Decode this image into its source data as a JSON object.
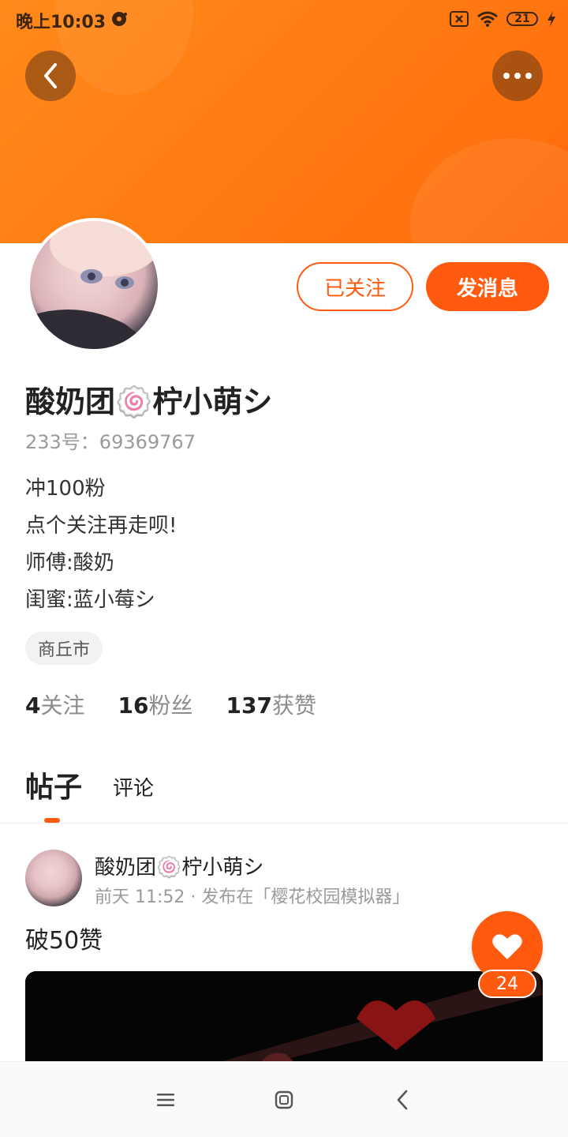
{
  "status_bar": {
    "time": "晚上10:03",
    "battery": "21"
  },
  "profile": {
    "name": "酸奶团🍥柠小萌シ",
    "uid": "233号：69369767",
    "bio": [
      "冲100粉",
      "点个关注再走呗!",
      "师傅:酸奶",
      "闺蜜:蓝小莓シ"
    ],
    "location": "商丘市",
    "follow_button": "已关注",
    "message_button": "发消息",
    "stats": [
      {
        "num": "4",
        "label": "关注"
      },
      {
        "num": "16",
        "label": "粉丝"
      },
      {
        "num": "137",
        "label": "获赞"
      }
    ]
  },
  "tabs": {
    "posts": "帖子",
    "comments": "评论"
  },
  "post": {
    "author": "酸奶团🍥柠小萌シ",
    "meta": "前天 11:52 · 发布在「樱花校园模拟器」",
    "text": "破50赞",
    "likes": "24"
  },
  "colors": {
    "accent": "#ff5a0e",
    "banner": "#ff7a12"
  }
}
